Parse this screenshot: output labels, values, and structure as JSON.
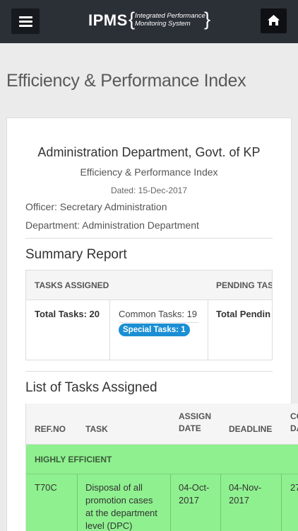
{
  "header": {
    "logo_main": "IPMS",
    "logo_sub_line1": "Integrated Performance",
    "logo_sub_line2": "Monitoring System",
    "brace_open": "{",
    "brace_close": "}",
    "menu_icon": "hamburger-menu-icon",
    "home_icon": "home-icon"
  },
  "page_title": "Efficiency & Performance Index",
  "report": {
    "department_title": "Administration Department, Govt. of KP",
    "index_title": "Efficiency & Performance Index",
    "dated": "Dated: 15-Dec-2017",
    "officer": "Officer: Secretary Administration",
    "department": "Department: Administration Department"
  },
  "summary": {
    "title": "Summary Report",
    "headers": [
      "TASKS ASSIGNED",
      "PENDING TAS"
    ],
    "total_tasks": "Total Tasks: 20",
    "common_tasks": "Common Tasks: 19",
    "special_tasks": "Special Tasks: 1",
    "total_pending": "Total Pendin"
  },
  "tasks": {
    "title": "List of Tasks Assigned",
    "headers": {
      "refno": "REF.NO",
      "task": "TASK",
      "assign_line1": "ASSIGN",
      "assign_line2": "DATE",
      "deadline": "DEADLINE",
      "extra_line1": "CO",
      "extra_line2": "DA"
    },
    "group_label": "HIGHLY EFFICIENT",
    "rows": [
      {
        "ref": "T70C",
        "task_line1": "Disposal of all",
        "task_line2": "promotion cases",
        "task_line3": "at the department",
        "task_line4": "level (DPC)",
        "assign_line1": "04-Oct-",
        "assign_line2": "2017",
        "deadline_line1": "04-Nov-",
        "deadline_line2": "2017",
        "extra": "27"
      }
    ]
  },
  "colors": {
    "topbar": "#2b2f36",
    "efficient_green": "#8ff08f",
    "badge_blue": "#1a8fd4"
  }
}
